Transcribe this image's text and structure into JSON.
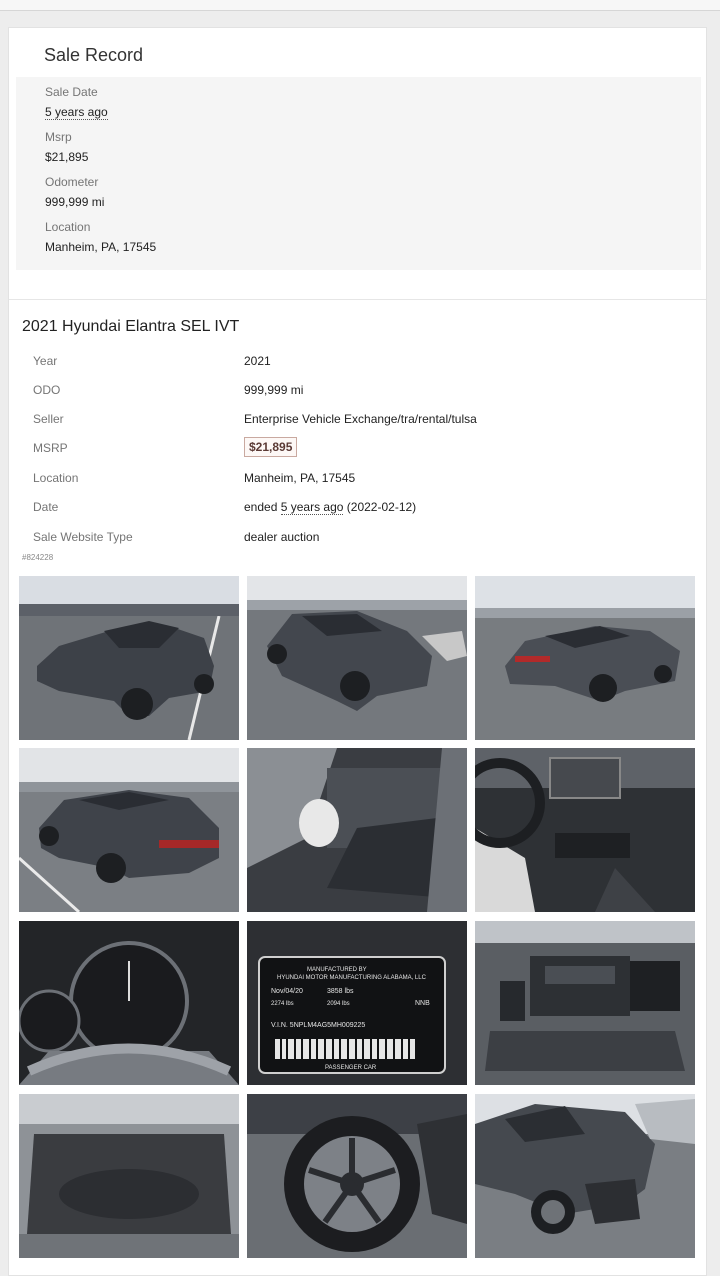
{
  "sale_record": {
    "title": "Sale Record",
    "fields": [
      {
        "label": "Sale Date",
        "value": "5 years ago"
      },
      {
        "label": "Msrp",
        "value": "$21,895"
      },
      {
        "label": "Odometer",
        "value": "999,999 mi"
      },
      {
        "label": "Location",
        "value": "Manheim, PA, 17545"
      }
    ]
  },
  "vehicle": {
    "title": "2021 Hyundai Elantra SEL IVT",
    "specs": [
      {
        "label": "Year",
        "value": "2021"
      },
      {
        "label": "ODO",
        "value": "999,999 mi"
      },
      {
        "label": "Seller",
        "value": "Enterprise Vehicle Exchange/tra/rental/tulsa"
      },
      {
        "label": "MSRP",
        "value": "$21,895"
      },
      {
        "label": "Location",
        "value": "Manheim, PA, 17545"
      },
      {
        "label": "Date",
        "prefix": "ended",
        "value": "5 years ago",
        "suffix": "(2022-02-12)"
      },
      {
        "label": "Sale Website Type",
        "value": "dealer auction"
      }
    ],
    "listing_id": "#824228"
  },
  "photos": [
    {
      "name": "front-left-damage"
    },
    {
      "name": "front-right-damage"
    },
    {
      "name": "rear-right"
    },
    {
      "name": "rear-left"
    },
    {
      "name": "interior-driver-airbag"
    },
    {
      "name": "dashboard-console"
    },
    {
      "name": "instrument-cluster"
    },
    {
      "name": "vin-label"
    },
    {
      "name": "engine-bay"
    },
    {
      "name": "trunk"
    },
    {
      "name": "wheel-tire"
    },
    {
      "name": "front-left-closeup"
    }
  ],
  "vin_label": {
    "line1": "MANUFACTURED BY",
    "line2": "HYUNDAI MOTOR MANUFACTURING ALABAMA, LLC",
    "date": "Nov/04/20",
    "gvwr": "3858 lbs",
    "front": "2274 lbs",
    "rear": "2094 lbs",
    "trim": "NNB",
    "vin": "V.I.N. 5NPLM4AG5MH009225",
    "type": "PASSENGER CAR"
  }
}
